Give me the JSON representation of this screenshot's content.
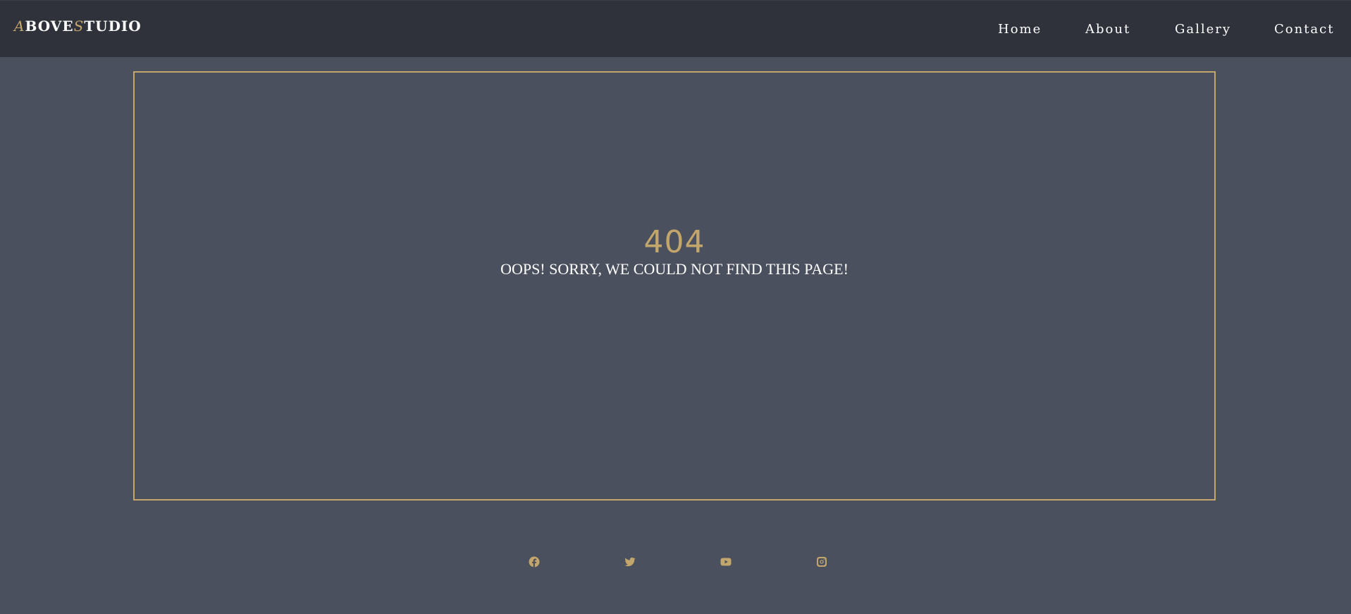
{
  "colors": {
    "background": "#4a505d",
    "header": "#2f323b",
    "accent": "#c3a66b",
    "text": "#ffffff"
  },
  "brand": {
    "logo_a": "A",
    "logo_bove": "BOVE",
    "logo_s": "S",
    "logo_tudio": "TUDIO"
  },
  "nav": {
    "items": [
      {
        "label": "Home"
      },
      {
        "label": "About"
      },
      {
        "label": "Gallery"
      },
      {
        "label": "Contact"
      }
    ]
  },
  "error": {
    "code": "404",
    "message": "OOPS! SORRY, WE COULD NOT FIND THIS PAGE!"
  },
  "social": {
    "icons": [
      "facebook-icon",
      "twitter-icon",
      "youtube-icon",
      "instagram-icon"
    ]
  }
}
